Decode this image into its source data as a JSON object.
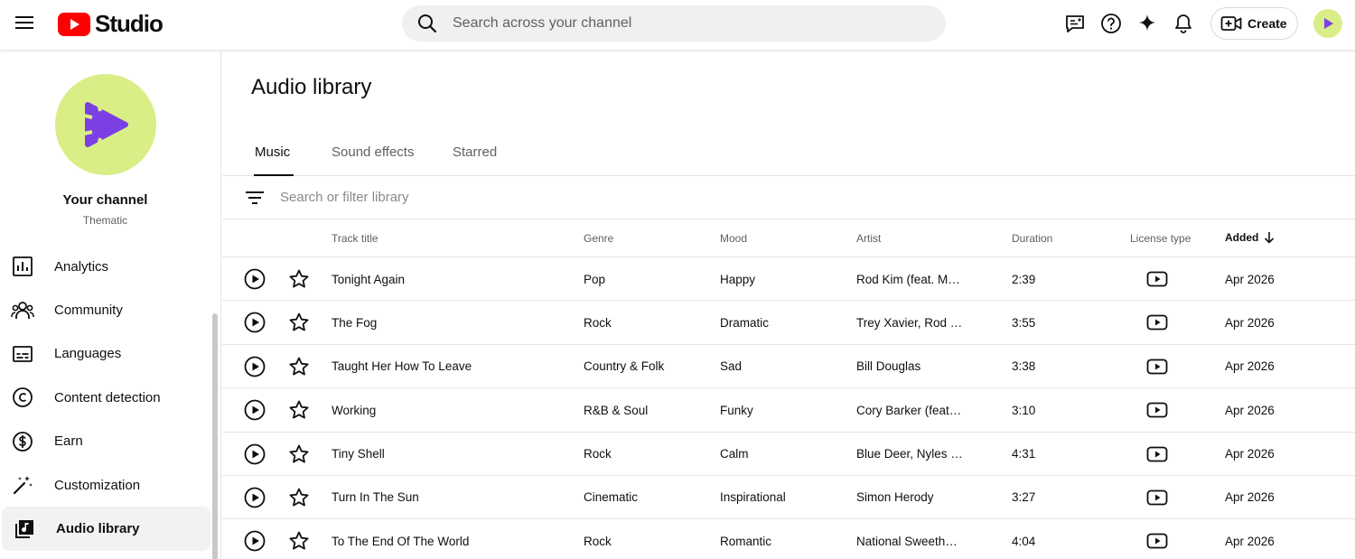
{
  "header": {
    "logo_text": "Studio",
    "search_placeholder": "Search across your channel",
    "create_label": "Create"
  },
  "sidebar": {
    "channel_name": "Your channel",
    "channel_subtitle": "Thematic",
    "items": [
      {
        "label": "Analytics",
        "icon": "analytics-icon"
      },
      {
        "label": "Community",
        "icon": "community-icon"
      },
      {
        "label": "Languages",
        "icon": "subtitles-icon"
      },
      {
        "label": "Content detection",
        "icon": "copyright-icon"
      },
      {
        "label": "Earn",
        "icon": "dollar-icon"
      },
      {
        "label": "Customization",
        "icon": "magic-wand-icon"
      },
      {
        "label": "Audio library",
        "icon": "music-library-icon"
      }
    ],
    "active_item": "Audio library"
  },
  "main": {
    "title": "Audio library",
    "tabs": [
      "Music",
      "Sound effects",
      "Starred"
    ],
    "active_tab": "Music",
    "filter_placeholder": "Search or filter library",
    "columns": [
      "Track title",
      "Genre",
      "Mood",
      "Artist",
      "Duration",
      "License type",
      "Added"
    ],
    "sort_column": "Added",
    "rows": [
      {
        "title": "Tonight Again",
        "genre": "Pop",
        "mood": "Happy",
        "artist": "Rod Kim (feat. Mo…",
        "duration": "2:39",
        "added": "Apr 2026"
      },
      {
        "title": "The Fog",
        "genre": "Rock",
        "mood": "Dramatic",
        "artist": "Trey Xavier, Rod K…",
        "duration": "3:55",
        "added": "Apr 2026"
      },
      {
        "title": "Taught Her How To Leave",
        "genre": "Country & Folk",
        "mood": "Sad",
        "artist": "Bill Douglas",
        "duration": "3:38",
        "added": "Apr 2026"
      },
      {
        "title": "Working",
        "genre": "R&B & Soul",
        "mood": "Funky",
        "artist": "Cory Barker (feat. …",
        "duration": "3:10",
        "added": "Apr 2026"
      },
      {
        "title": "Tiny Shell",
        "genre": "Rock",
        "mood": "Calm",
        "artist": "Blue Deer, Nyles L…",
        "duration": "4:31",
        "added": "Apr 2026"
      },
      {
        "title": "Turn In The Sun",
        "genre": "Cinematic",
        "mood": "Inspirational",
        "artist": "Simon Herody",
        "duration": "3:27",
        "added": "Apr 2026"
      },
      {
        "title": "To The End Of The World",
        "genre": "Rock",
        "mood": "Romantic",
        "artist": "National Sweethe…",
        "duration": "4:04",
        "added": "Apr 2026"
      }
    ]
  },
  "colors": {
    "brand_red": "#ff0000",
    "avatar_bg": "#d9ee86",
    "avatar_glyph": "#7b3fe4",
    "active_nav_bg": "#f2f2f2"
  }
}
